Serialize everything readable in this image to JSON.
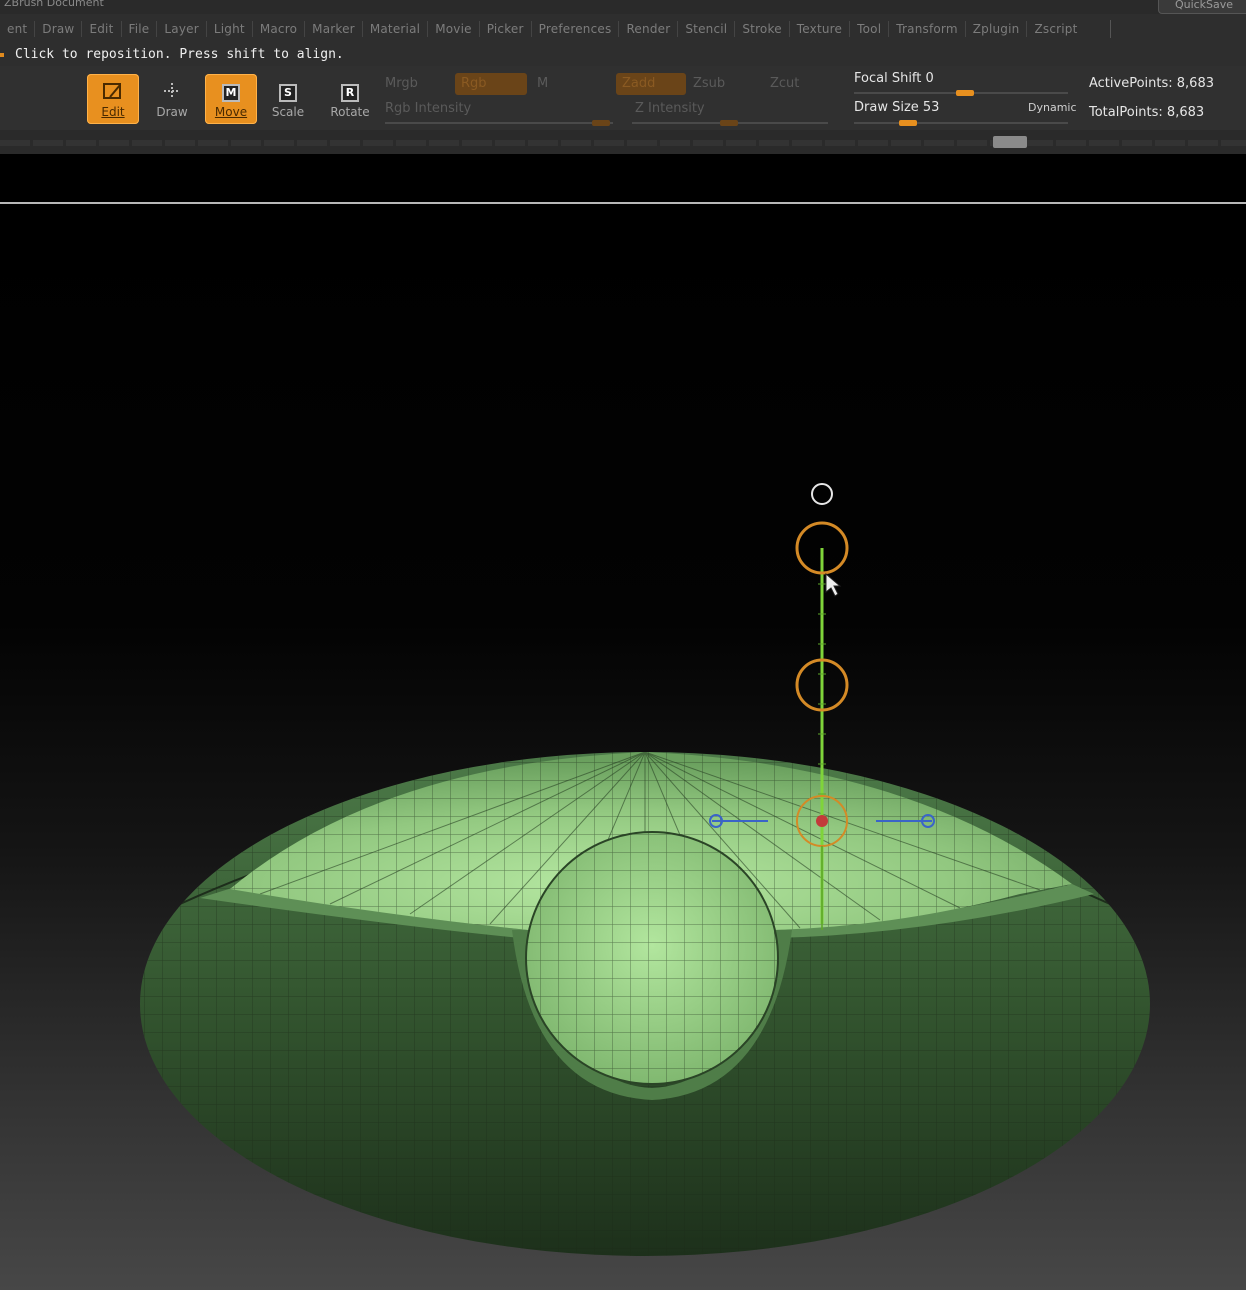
{
  "titlebar": {
    "title": "ZBrush Document",
    "quicksave": "QuickSave"
  },
  "menubar": {
    "items": [
      "ent",
      "Draw",
      "Edit",
      "File",
      "Layer",
      "Light",
      "Macro",
      "Marker",
      "Material",
      "Movie",
      "Picker",
      "Preferences",
      "Render",
      "Stencil",
      "Stroke",
      "Texture",
      "Tool",
      "Transform",
      "Zplugin",
      "Zscript"
    ]
  },
  "status": {
    "message": "Click to reposition. Press shift to align."
  },
  "shelf": {
    "tools": [
      {
        "label": "Edit",
        "active": true,
        "icon": "edit-icon"
      },
      {
        "label": "Draw",
        "active": false,
        "icon": "draw-icon"
      },
      {
        "label": "Move",
        "active": true,
        "icon": "move-icon",
        "badge": "M"
      },
      {
        "label": "Scale",
        "active": false,
        "icon": "scale-icon",
        "badge": "S"
      },
      {
        "label": "Rotate",
        "active": false,
        "icon": "rotate-icon",
        "badge": "R"
      }
    ],
    "mrgb": "Mrgb",
    "rgb": "Rgb",
    "m": "M",
    "rgb_intensity": "Rgb Intensity",
    "zadd": "Zadd",
    "zsub": "Zsub",
    "zcut": "Zcut",
    "z_intensity": "Z Intensity",
    "focal_shift": "Focal Shift 0",
    "draw_size": "Draw Size 53",
    "dynamic": "Dynamic",
    "active_points": "ActivePoints: 8,683",
    "total_points": "TotalPoints: 8,683"
  },
  "sliders": {
    "focal_shift_value": 0,
    "draw_size_value": 53
  },
  "colors": {
    "accent": "#e8901f",
    "mesh_light": "#a6dc92",
    "mesh_dark": "#2c4a2a",
    "gizmo_axis": "#7fd43a",
    "gizmo_ring": "#d48a26",
    "gizmo_side": "#3a64c8"
  }
}
